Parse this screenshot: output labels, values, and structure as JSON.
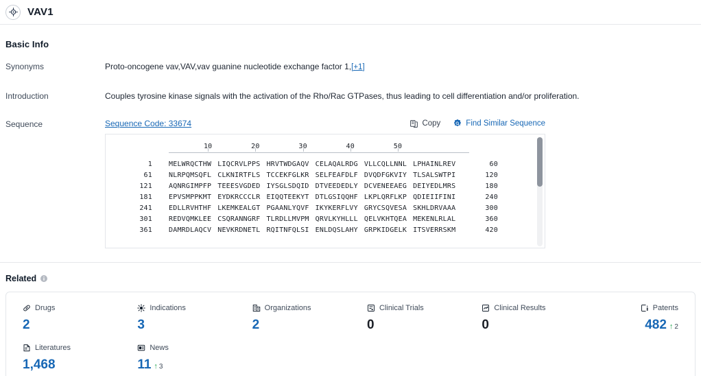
{
  "header": {
    "icon": "target-icon",
    "title": "VAV1"
  },
  "basic_info": {
    "section_title": "Basic Info",
    "rows": [
      {
        "label": "Synonyms",
        "value": "Proto-oncogene vav,VAV,vav guanine nucleotide exchange factor 1,",
        "more_label": "[+1]"
      },
      {
        "label": "Introduction",
        "value": "Couples tyrosine kinase signals with the activation of the Rho/Rac GTPases, thus leading to cell differentiation and/or proliferation."
      },
      {
        "label": "Sequence"
      }
    ]
  },
  "sequence": {
    "code_label": "Sequence Code: 33674",
    "copy_label": "Copy",
    "find_similar_label": "Find Similar Sequence",
    "ruler": [
      "10",
      "20",
      "30",
      "40",
      "50"
    ],
    "lines": [
      {
        "start": "1",
        "chunks": [
          "MELWRQCTHW",
          "LIQCRVLPPS",
          "HRVTWDGAQV",
          "CELAQALRDG",
          "VLLCQLLNNL",
          "LPHAINLREV"
        ],
        "end": "60"
      },
      {
        "start": "61",
        "chunks": [
          "NLRPQMSQFL",
          "CLKNIRTFLS",
          "TCCEKFGLKR",
          "SELFEAFDLF",
          "DVQDFGKVIY",
          "TLSALSWTPI"
        ],
        "end": "120"
      },
      {
        "start": "121",
        "chunks": [
          "AQNRGIMPFP",
          "TEEESVGDED",
          "IYSGLSDQID",
          "DTVEEDEDLY",
          "DCVENEEAEG",
          "DEIYEDLMRS"
        ],
        "end": "180"
      },
      {
        "start": "181",
        "chunks": [
          "EPVSMPPKMT",
          "EYDKRCCCLR",
          "EIQQTEEKYT",
          "DTLGSIQQHF",
          "LKPLQRFLKP",
          "QDIEIIFINI"
        ],
        "end": "240"
      },
      {
        "start": "241",
        "chunks": [
          "EDLLRVHTHF",
          "LKEMKEALGT",
          "PGAANLYQVF",
          "IKYKERFLVY",
          "GRYCSQVESA",
          "SKHLDRVAAA"
        ],
        "end": "300"
      },
      {
        "start": "301",
        "chunks": [
          "REDVQMKLEE",
          "CSQRANNGRF",
          "TLRDLLMVPM",
          "QRVLKYHLLL",
          "QELVKHTQEA",
          "MEKENLRLAL"
        ],
        "end": "360"
      },
      {
        "start": "361",
        "chunks": [
          "DAMRDLAQCV",
          "NEVKRDNETL",
          "RQITNFQLSI",
          "ENLDQSLAHY",
          "GRPKIDGELK",
          "ITSVERRSKM"
        ],
        "end": "420"
      }
    ]
  },
  "related": {
    "title": "Related",
    "info_icon": "info-icon",
    "stats": [
      {
        "icon": "pill-icon",
        "label": "Drugs",
        "value": "2",
        "zero": false,
        "delta": null
      },
      {
        "icon": "virus-icon",
        "label": "Indications",
        "value": "3",
        "zero": false,
        "delta": null
      },
      {
        "icon": "building-icon",
        "label": "Organizations",
        "value": "2",
        "zero": false,
        "delta": null
      },
      {
        "icon": "clipboard-icon",
        "label": "Clinical Trials",
        "value": "0",
        "zero": true,
        "delta": null
      },
      {
        "icon": "results-icon",
        "label": "Clinical Results",
        "value": "0",
        "zero": true,
        "delta": null
      },
      {
        "icon": "patent-icon",
        "label": "Patents",
        "value": "482",
        "zero": false,
        "delta": "2"
      },
      {
        "icon": "book-icon",
        "label": "Literatures",
        "value": "1,468",
        "zero": false,
        "delta": null
      },
      {
        "icon": "news-icon",
        "label": "News",
        "value": "11",
        "zero": false,
        "delta": "3"
      }
    ],
    "delta_arrow": "↑"
  },
  "colors": {
    "link_blue": "#1767b5",
    "value_blue": "#1767b5",
    "delta_green": "#23a24d",
    "text_dark": "#1c2430",
    "border": "#e3e6ea"
  }
}
